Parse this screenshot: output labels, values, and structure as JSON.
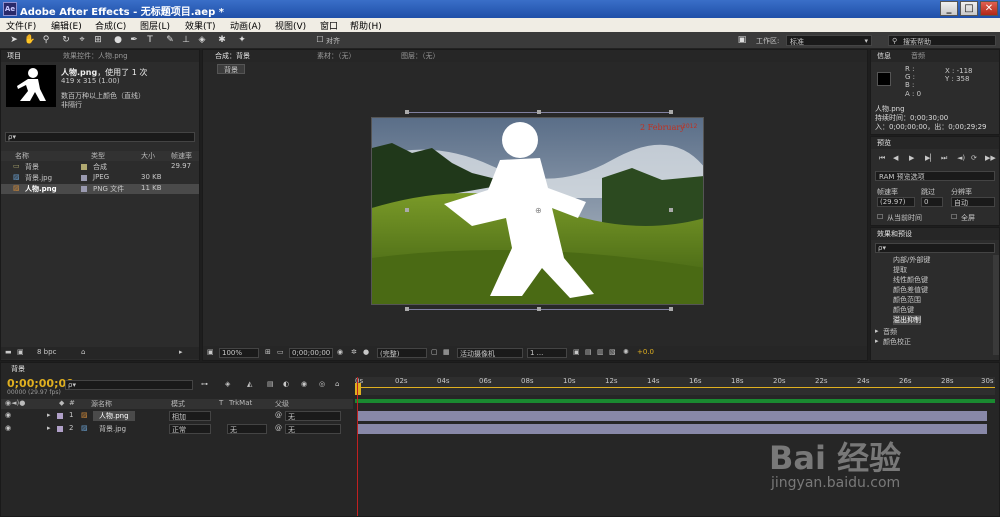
{
  "window": {
    "app_icon": "Ae",
    "title": "Adobe After Effects - 无标题项目.aep *",
    "controls": [
      "_",
      "□",
      "✕"
    ]
  },
  "menu": [
    "文件(F)",
    "编辑(E)",
    "合成(C)",
    "图层(L)",
    "效果(T)",
    "动画(A)",
    "视图(V)",
    "窗口",
    "帮助(H)"
  ],
  "toolbar": {
    "align_label": "对齐",
    "workspace_label": "工作区:",
    "workspace_value": "标准",
    "search_placeholder": "搜索帮助"
  },
  "project_panel": {
    "tab_project": "项目",
    "tab_effects": "效果控件：人物.png",
    "item_name": "人物.png",
    "item_usage": "，使用了 1 次",
    "item_size": "419 x 315 (1.00)",
    "item_desc1": "数百万种以上颜色（直线）",
    "item_desc2": "非隔行",
    "search_placeholder": "ρ▾",
    "headers": [
      "名称",
      "类型",
      "大小",
      "帧速率"
    ],
    "items": [
      {
        "name": "背景",
        "type": "合成",
        "size": "",
        "fps": "29.97",
        "color": "#b0a870",
        "icon": "comp-icon"
      },
      {
        "name": "背景.jpg",
        "type": "JPEG",
        "size": "30 KB",
        "fps": "",
        "color": "#9a9ab0",
        "icon": "image-icon"
      },
      {
        "name": "人物.png",
        "type": "PNG 文件",
        "size": "11 KB",
        "fps": "",
        "color": "#9a9ab0",
        "icon": "image-icon"
      }
    ],
    "bpc": "8 bpc"
  },
  "comp_panel": {
    "tab_comp": "合成：背景",
    "tab_footage": "素材：（无）",
    "tab_layer": "图层：（无）",
    "breadcrumb": "背景",
    "zoom": "100%",
    "timecode": "0;00;00;00",
    "resolution": "(完整)",
    "camera": "活动摄像机",
    "views": "1 ...",
    "exposure": "+0.0"
  },
  "info_panel": {
    "tab_info": "信息",
    "tab_audio": "音频",
    "r": "R :",
    "g": "G :",
    "b": "B :",
    "a": "A : 0",
    "x": "X : -118",
    "y": "Y : 358",
    "layer_name": "人物.png",
    "duration": "持续时间：0;00;30;00",
    "in_out": "入：0;00;00;00，出：0;00;29;29"
  },
  "preview_panel": {
    "tab": "预览",
    "ram_label": "RAM 预览选项",
    "fps_label": "帧速率",
    "skip_label": "跳过",
    "res_label": "分辨率",
    "fps_value": "(29.97)",
    "skip_value": "0",
    "res_value": "自动",
    "from_current": "从当前时间",
    "fullscreen": "全屏"
  },
  "effects_panel": {
    "tab": "效果和预设",
    "search_placeholder": "ρ▾",
    "items": [
      "内部/外部键",
      "提取",
      "线性颜色键",
      "颜色差值键",
      "颜色范围",
      "颜色键",
      "溢出抑制"
    ],
    "categories": [
      "音频",
      "颜色校正"
    ]
  },
  "timeline": {
    "tab": "背景",
    "timecode": "0;00;00;00",
    "fps_note": "00000 (29.97 fps)",
    "search_placeholder": "ρ▾",
    "col_name": "源名称",
    "col_mode": "模式",
    "col_t": "T",
    "col_trkmat": "TrkMat",
    "col_parent": "父级",
    "ruler": [
      "0s",
      "02s",
      "04s",
      "06s",
      "08s",
      "10s",
      "12s",
      "14s",
      "16s",
      "18s",
      "20s",
      "22s",
      "24s",
      "26s",
      "28s",
      "30s"
    ],
    "layers": [
      {
        "num": "1",
        "name": "人物.png",
        "mode": "相加",
        "trkmat": "",
        "parent": "无",
        "color": "#b0a0c8"
      },
      {
        "num": "2",
        "name": "背景.jpg",
        "mode": "正常",
        "trkmat": "无",
        "parent": "无",
        "color": "#b0a0c8"
      }
    ]
  },
  "watermark": {
    "brand": "Bai 经验",
    "url": "jingyan.baidu.com"
  },
  "calendar_overlay": {
    "month": "2 February",
    "year": "2012"
  }
}
